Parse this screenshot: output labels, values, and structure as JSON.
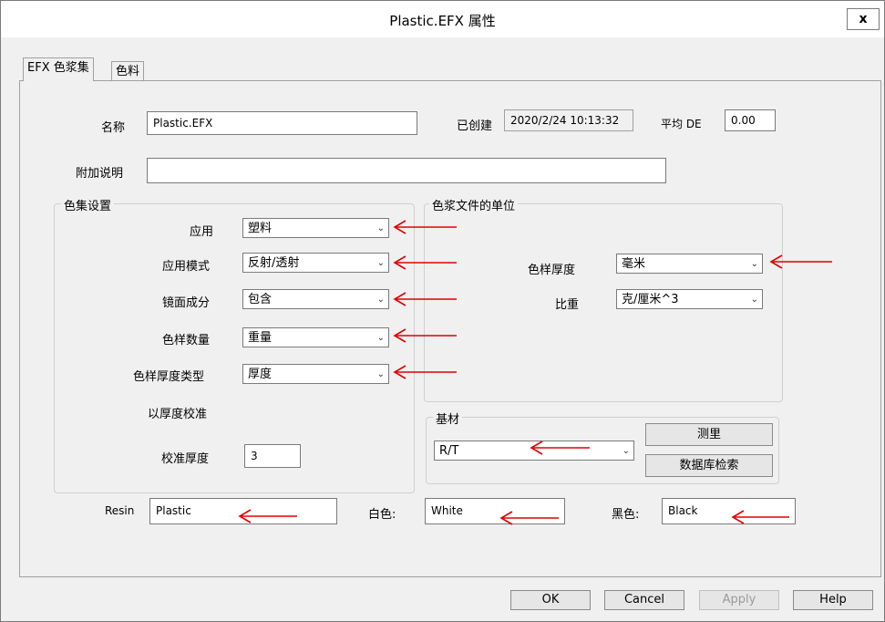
{
  "window": {
    "title": "Plastic.EFX 属性",
    "close_label": "x"
  },
  "tabs": [
    {
      "label": "EFX 色浆集"
    },
    {
      "label": "色料"
    }
  ],
  "fields": {
    "name_label": "名称",
    "name_value": "Plastic.EFX",
    "created_label": "已创建",
    "created_value": "2020/2/24 10:13:32",
    "avg_de_label": "平均 DE",
    "avg_de_value": "0.00",
    "note_label": "附加说明",
    "note_value": ""
  },
  "color_set": {
    "title": "色集设置",
    "application_label": "应用",
    "application_value": "塑料",
    "app_mode_label": "应用模式",
    "app_mode_value": "反射/透射",
    "specular_label": "镜面成分",
    "specular_value": "包含",
    "sample_qty_label": "色样数量",
    "sample_qty_value": "重量",
    "thickness_type_label": "色样厚度类型",
    "thickness_type_value": "厚度",
    "calibrate_by_thickness_label": "以厚度校准",
    "calib_thickness_label": "校准厚度",
    "calib_thickness_value": "3"
  },
  "units": {
    "title": "色浆文件的单位",
    "sample_thickness_label": "色样厚度",
    "sample_thickness_value": "毫米",
    "specific_gravity_label": "比重",
    "specific_gravity_value": "克/厘米^3"
  },
  "substrate": {
    "title": "基材",
    "value": "R/T",
    "measure_label": "测里",
    "db_search_label": "数据库检索"
  },
  "materials": {
    "resin_label": "Resin",
    "resin_value": "Plastic",
    "white_label": "白色:",
    "white_value": "White",
    "black_label": "黑色:",
    "black_value": "Black"
  },
  "buttons": {
    "ok": "OK",
    "cancel": "Cancel",
    "apply": "Apply",
    "help": "Help"
  },
  "colors": {
    "annotation_arrow": "#e00000",
    "window_bg": "#f0f0f0"
  }
}
